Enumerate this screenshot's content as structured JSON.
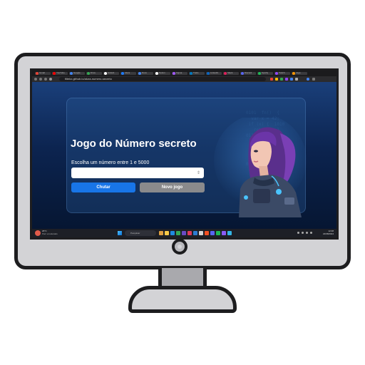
{
  "browser": {
    "tabs": [
      {
        "label": "Gmail",
        "color": "#ea4335"
      },
      {
        "label": "YouTube",
        "color": "#ff0000"
      },
      {
        "label": "Google",
        "color": "#4285f4"
      },
      {
        "label": "Drive",
        "color": "#34a853"
      },
      {
        "label": "GitHub",
        "color": "#ffffff"
      },
      {
        "label": "Alura",
        "color": "#1c7bff"
      },
      {
        "label": "Docs",
        "color": "#4285f4"
      },
      {
        "label": "Notion",
        "color": "#ffffff"
      },
      {
        "label": "Figma",
        "color": "#a259ff"
      },
      {
        "label": "Trello",
        "color": "#0079bf"
      },
      {
        "label": "LinkedIn",
        "color": "#0a66c2"
      },
      {
        "label": "Slack",
        "color": "#e01e5a"
      },
      {
        "label": "Discord",
        "color": "#5865f2"
      },
      {
        "label": "Spotify",
        "color": "#1db954"
      },
      {
        "label": "Twitch",
        "color": "#9146ff"
      },
      {
        "label": "Jogo",
        "color": "#ff9800"
      }
    ],
    "url": "filtekx.github.io/alura-numero-secreto"
  },
  "page": {
    "title": "Jogo do Número secreto",
    "subtitle": "Escolha um número entre 1 e 5000",
    "input_value": "",
    "stepper_icon": "stepper-icon",
    "buttons": {
      "guess": "Chutar",
      "new_game": "Novo jogo"
    },
    "colors": {
      "primary": "#1875e8",
      "secondary": "#8a8a8c",
      "background": "#0c2450"
    }
  },
  "taskbar": {
    "weather_temp": "26°C",
    "weather_desc": "Parc ensolarado",
    "search_placeholder": "Pesquisar",
    "time": "12:08",
    "date": "22/08/2024"
  }
}
